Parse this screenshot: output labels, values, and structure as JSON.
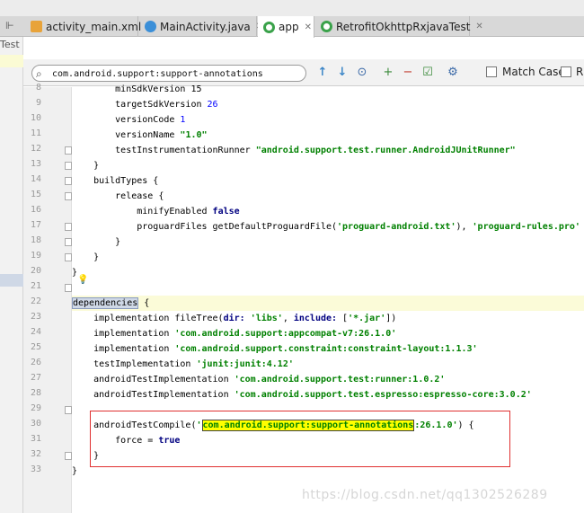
{
  "tabs": [
    {
      "label": "activity_main.xml",
      "icon": "xml-file-icon",
      "active": false
    },
    {
      "label": "MainActivity.java",
      "icon": "java-class-icon",
      "active": false
    },
    {
      "label": "app",
      "icon": "gradle-module-icon",
      "active": true
    },
    {
      "label": "RetrofitOkhttpRxjavaTest",
      "icon": "project-gradle-icon",
      "active": false
    }
  ],
  "left_panel": {
    "label": "Test"
  },
  "search": {
    "value": "com.android.support:support-annotations",
    "match_case_label": "Match Case",
    "regex_label_partial": "R"
  },
  "editor": {
    "line_numbers": [
      "8",
      "9",
      "10",
      "11",
      "12",
      "13",
      "14",
      "15",
      "16",
      "17",
      "18",
      "19",
      "20",
      "21",
      "22",
      "23",
      "24",
      "25",
      "26",
      "27",
      "28",
      "29",
      "30",
      "31",
      "32",
      "33"
    ],
    "lines": [
      {
        "n": "8",
        "segs": [
          {
            "t": "        minSdkVersion 15",
            "c": ""
          }
        ]
      },
      {
        "n": "9",
        "segs": [
          {
            "t": "        targetSdkVersion ",
            "c": ""
          },
          {
            "t": "26",
            "c": "num-lit"
          }
        ]
      },
      {
        "n": "10",
        "segs": [
          {
            "t": "        versionCode ",
            "c": ""
          },
          {
            "t": "1",
            "c": "num-lit"
          }
        ]
      },
      {
        "n": "11",
        "segs": [
          {
            "t": "        versionName ",
            "c": ""
          },
          {
            "t": "\"1.0\"",
            "c": "str"
          }
        ]
      },
      {
        "n": "12",
        "segs": [
          {
            "t": "        testInstrumentationRunner ",
            "c": ""
          },
          {
            "t": "\"android.support.test.runner.AndroidJUnitRunner\"",
            "c": "str"
          }
        ]
      },
      {
        "n": "13",
        "segs": [
          {
            "t": "    }",
            "c": ""
          }
        ]
      },
      {
        "n": "14",
        "segs": [
          {
            "t": "    buildTypes {",
            "c": ""
          }
        ]
      },
      {
        "n": "15",
        "segs": [
          {
            "t": "        release {",
            "c": ""
          }
        ]
      },
      {
        "n": "16",
        "segs": [
          {
            "t": "            minifyEnabled ",
            "c": ""
          },
          {
            "t": "false",
            "c": "kw"
          }
        ]
      },
      {
        "n": "17",
        "segs": [
          {
            "t": "            proguardFiles getDefaultProguardFile(",
            "c": ""
          },
          {
            "t": "'proguard-android.txt'",
            "c": "str"
          },
          {
            "t": "), ",
            "c": ""
          },
          {
            "t": "'proguard-rules.pro'",
            "c": "str"
          }
        ]
      },
      {
        "n": "18",
        "segs": [
          {
            "t": "        }",
            "c": ""
          }
        ]
      },
      {
        "n": "19",
        "segs": [
          {
            "t": "    }",
            "c": ""
          }
        ]
      },
      {
        "n": "20",
        "segs": [
          {
            "t": "}",
            "c": ""
          }
        ]
      },
      {
        "n": "21",
        "segs": [
          {
            "t": "",
            "c": ""
          }
        ]
      },
      {
        "n": "22",
        "segs": [
          {
            "t": "dependencies",
            "c": "hl-word"
          },
          {
            "t": " {",
            "c": ""
          }
        ]
      },
      {
        "n": "23",
        "segs": [
          {
            "t": "    implementation fileTree(",
            "c": ""
          },
          {
            "t": "dir: ",
            "c": "kw"
          },
          {
            "t": "'libs'",
            "c": "str"
          },
          {
            "t": ", ",
            "c": ""
          },
          {
            "t": "include: ",
            "c": "kw"
          },
          {
            "t": "[",
            "c": ""
          },
          {
            "t": "'*.jar'",
            "c": "str"
          },
          {
            "t": "])",
            "c": ""
          }
        ]
      },
      {
        "n": "24",
        "segs": [
          {
            "t": "    implementation ",
            "c": ""
          },
          {
            "t": "'com.android.support:appcompat-v7:26.1.0'",
            "c": "str"
          }
        ]
      },
      {
        "n": "25",
        "segs": [
          {
            "t": "    implementation ",
            "c": ""
          },
          {
            "t": "'com.android.support.constraint:constraint-layout:1.1.3'",
            "c": "str"
          }
        ]
      },
      {
        "n": "26",
        "segs": [
          {
            "t": "    testImplementation ",
            "c": ""
          },
          {
            "t": "'junit:junit:4.12'",
            "c": "str"
          }
        ]
      },
      {
        "n": "27",
        "segs": [
          {
            "t": "    androidTestImplementation ",
            "c": ""
          },
          {
            "t": "'com.android.support.test:runner:1.0.2'",
            "c": "str"
          }
        ]
      },
      {
        "n": "28",
        "segs": [
          {
            "t": "    androidTestImplementation ",
            "c": ""
          },
          {
            "t": "'com.android.support.test.espresso:espresso-core:3.0.2'",
            "c": "str"
          }
        ]
      },
      {
        "n": "29",
        "segs": [
          {
            "t": "",
            "c": ""
          }
        ]
      },
      {
        "n": "30",
        "segs": [
          {
            "t": "    androidTestCompile(",
            "c": ""
          },
          {
            "t": "'",
            "c": "str"
          },
          {
            "t": "com.android.support:support-annotations",
            "c": "hl-search str"
          },
          {
            "t": ":26.1.0'",
            "c": "str"
          },
          {
            "t": ") {",
            "c": ""
          }
        ]
      },
      {
        "n": "31",
        "segs": [
          {
            "t": "        force = ",
            "c": ""
          },
          {
            "t": "true",
            "c": "kw"
          }
        ]
      },
      {
        "n": "32",
        "segs": [
          {
            "t": "    }",
            "c": ""
          }
        ]
      },
      {
        "n": "33",
        "segs": [
          {
            "t": "}",
            "c": ""
          }
        ]
      }
    ]
  },
  "watermark": "https://blog.csdn.net/qq1302526289"
}
